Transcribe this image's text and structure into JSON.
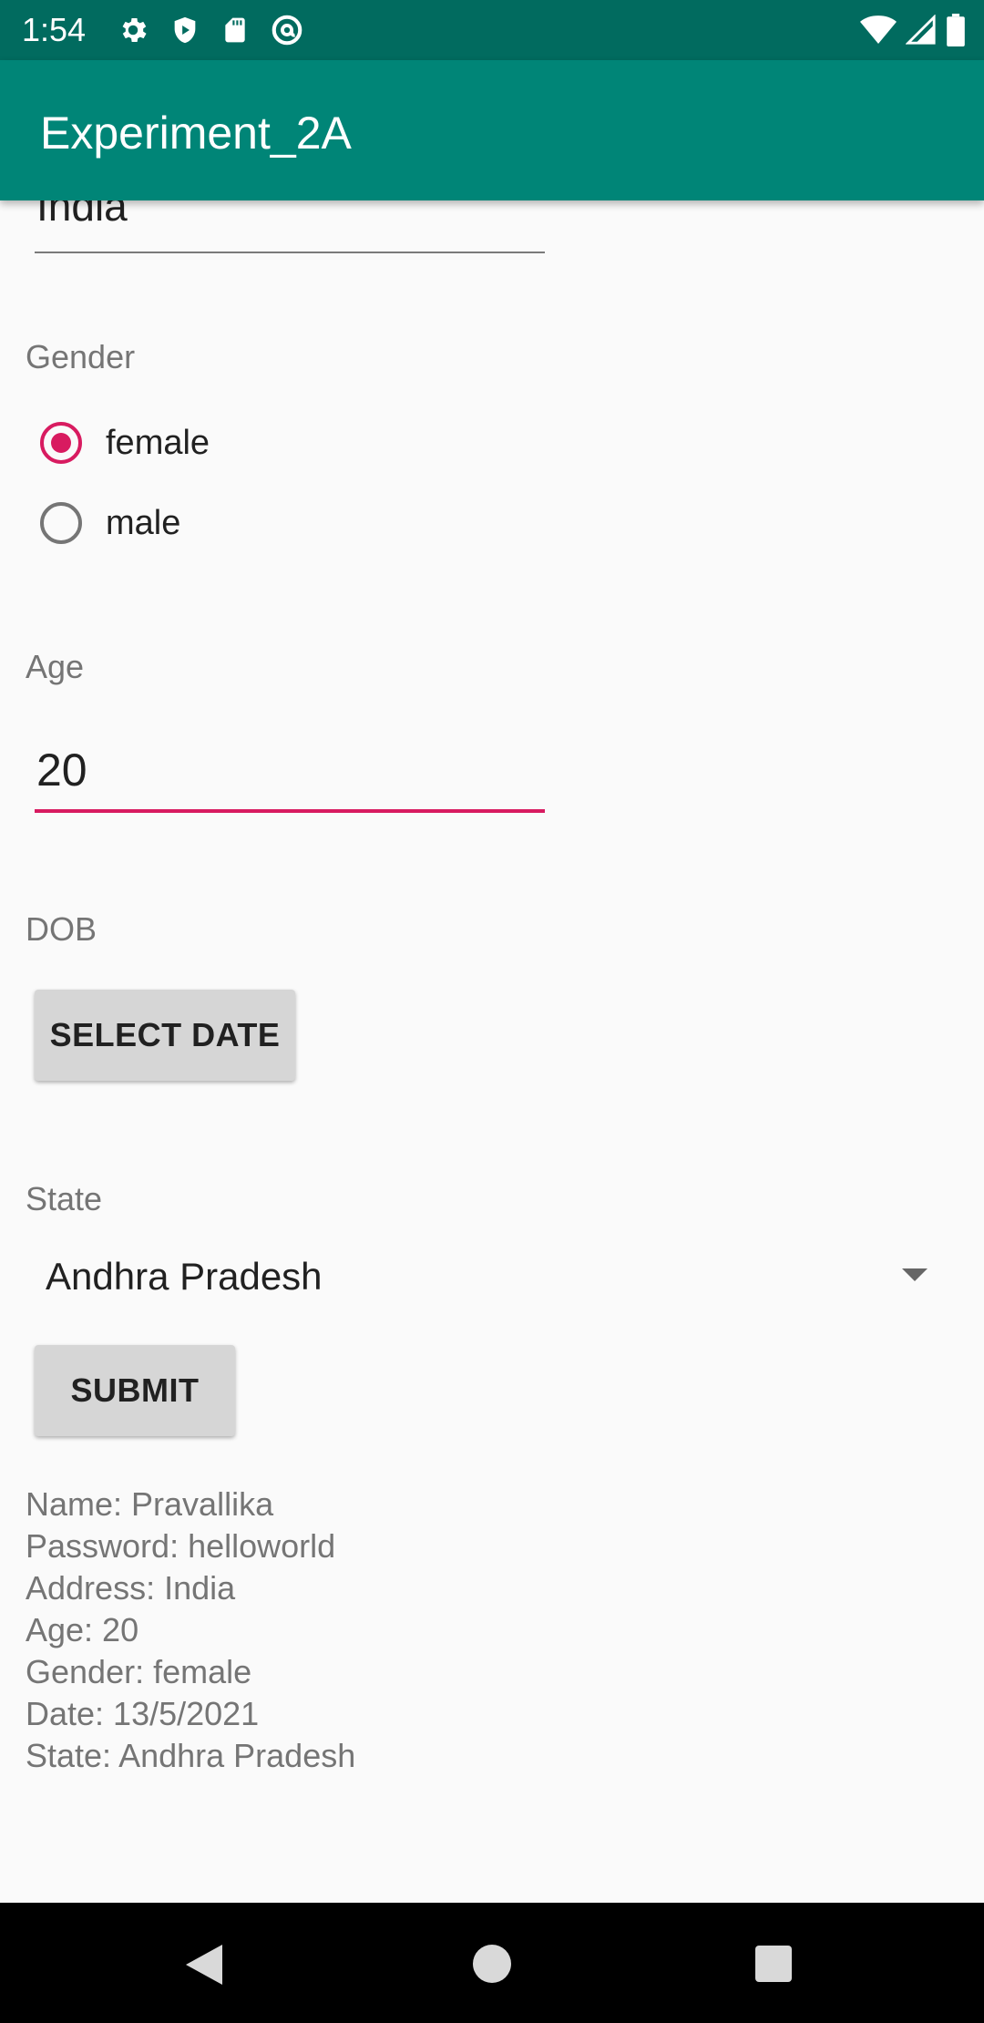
{
  "status_bar": {
    "time": "1:54",
    "left_icons": [
      "gear-icon",
      "shield-icon",
      "sd-card-icon",
      "at-sign-icon"
    ],
    "right_icons": [
      "wifi-icon",
      "cell-signal-icon",
      "battery-icon"
    ]
  },
  "app_bar": {
    "title": "Experiment_2A",
    "color": "#008577",
    "status_color": "#016b5f"
  },
  "form": {
    "address_value": "India",
    "gender_label": "Gender",
    "gender_options": [
      {
        "label": "female",
        "checked": true
      },
      {
        "label": "male",
        "checked": false
      }
    ],
    "age_label": "Age",
    "age_value": "20",
    "dob_label": "DOB",
    "select_date_button": "SELECT DATE",
    "state_label": "State",
    "state_selected": "Andhra Pradesh",
    "submit_button": "SUBMIT",
    "accent_color": "#d81b60"
  },
  "result": {
    "lines": [
      "Name: Pravallika",
      "Password: helloworld",
      "Address: India",
      "Age: 20",
      "Gender: female",
      "Date: 13/5/2021",
      "State: Andhra Pradesh"
    ]
  },
  "nav_bar": {
    "buttons": [
      "back-icon",
      "home-icon",
      "recents-icon"
    ]
  }
}
